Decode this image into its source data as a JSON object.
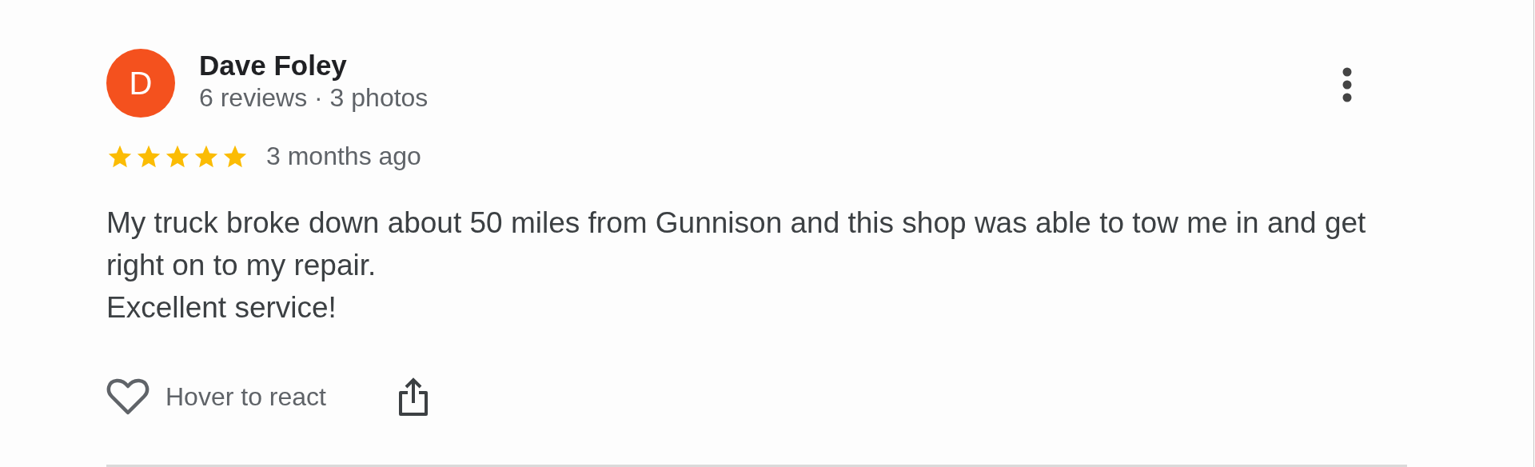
{
  "review": {
    "reviewer": "Dave Foley",
    "avatar_initial": "D",
    "meta": "6 reviews · 3 photos",
    "stars": 5,
    "time": "3 months ago",
    "text": "My truck broke down about 50 miles from Gunnison and this shop was able to tow me in and get right on to my repair.\nExcellent service!",
    "react_label": "Hover to react"
  }
}
